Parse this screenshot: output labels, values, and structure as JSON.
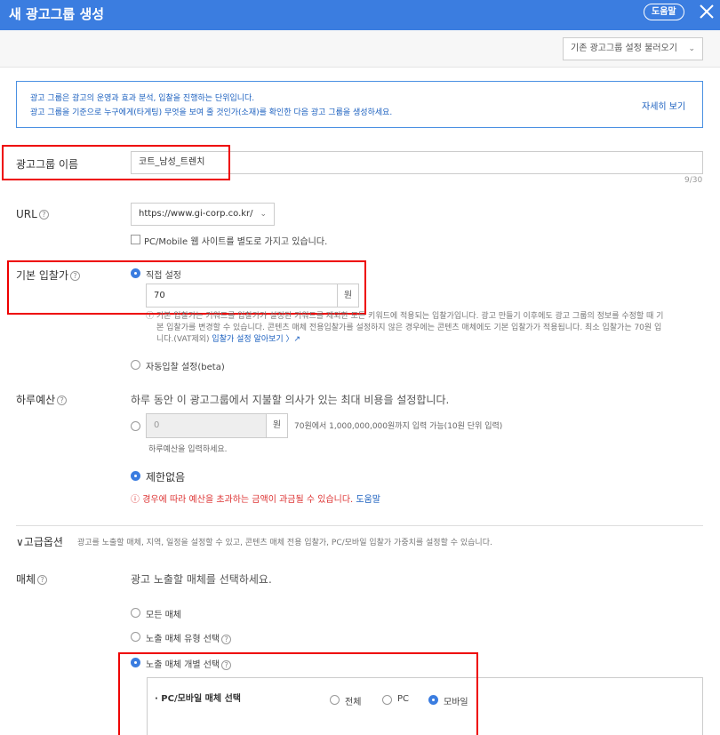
{
  "header": {
    "title": "새 광고그룹 생성",
    "help_label": "도움말"
  },
  "toolbar": {
    "load_select_label": "기존 광고그룹 설정 불러오기"
  },
  "info": {
    "line1": "광고 그룹은 광고의 운영과 효과 분석, 입찰을 진행하는 단위입니다.",
    "line2": "광고 그룹을 기준으로 누구에게(타게팅) 무엇을 보여 줄 것인가(소재)를 확인한 다음 광고 그룹을 생성하세요.",
    "more_link": "자세히 보기"
  },
  "group_name": {
    "label": "광고그룹 이름",
    "value": "코트_남성_트렌치",
    "counter": "9/30"
  },
  "url": {
    "label": "URL",
    "value": "https://www.gi-corp.co.kr/",
    "checkbox_label": "PC/Mobile 웹 사이트를 별도로 가지고 있습니다."
  },
  "bid": {
    "label": "기본 입찰가",
    "manual_option": "직접 설정",
    "value": "70",
    "unit": "원",
    "note_line1": "기본 입찰가는 키워드를 입찰가가 설정된 키워드를 제외한 모든 키워드에 적용되는 입찰가입니다. 광고 만들기 이후에도 광고 그룹의 정보를 수정할 때 기",
    "note_line2": "본 입찰가를 변경할 수 있습니다. 콘텐츠 매체 전용입찰가를 설정하지 않은 경우에는 콘텐츠 매체에도 기본 입찰가가 적용됩니다. 최소 입찰가는 70원 입",
    "note_line3": "니다.(VAT제외)",
    "note_link": "입찰가 설정 알아보기",
    "auto_option": "자동입찰 설정(beta)"
  },
  "budget": {
    "label": "하루예산",
    "description": "하루 동안 이 광고그룹에서 지불할 의사가 있는 최대 비용을 설정합니다.",
    "value": "0",
    "unit": "원",
    "range_text": "70원에서 1,000,000,000원까지 입력 가능(10원 단위 입력)",
    "hint": "하루예산을 입력하세요.",
    "unlimited_option": "제한없음",
    "warning": "경우에 따라 예산을 초과하는 금액이 과금될 수 있습니다.",
    "warning_link": "도움말"
  },
  "advanced": {
    "toggle_label": "고급옵션",
    "description": "광고를 노출할 매체, 지역, 일정을 설정할 수 있고, 콘텐츠 매체 전용 입찰가, PC/모바일 입찰가 가중치를 설정할 수 있습니다."
  },
  "media": {
    "label": "매체",
    "description": "광고 노출할 매체를 선택하세요.",
    "option_all": "모든 매체",
    "option_type": "노출 매체 유형 선택",
    "option_individual": "노출 매체 개별 선택",
    "panel_title": "PC/모바일 매체 선택",
    "device_all": "전체",
    "device_pc": "PC",
    "device_mobile": "모바일"
  },
  "colors": {
    "header_bg": "#3b7de0",
    "highlight": "#e00000",
    "link": "#1a5fbf"
  }
}
